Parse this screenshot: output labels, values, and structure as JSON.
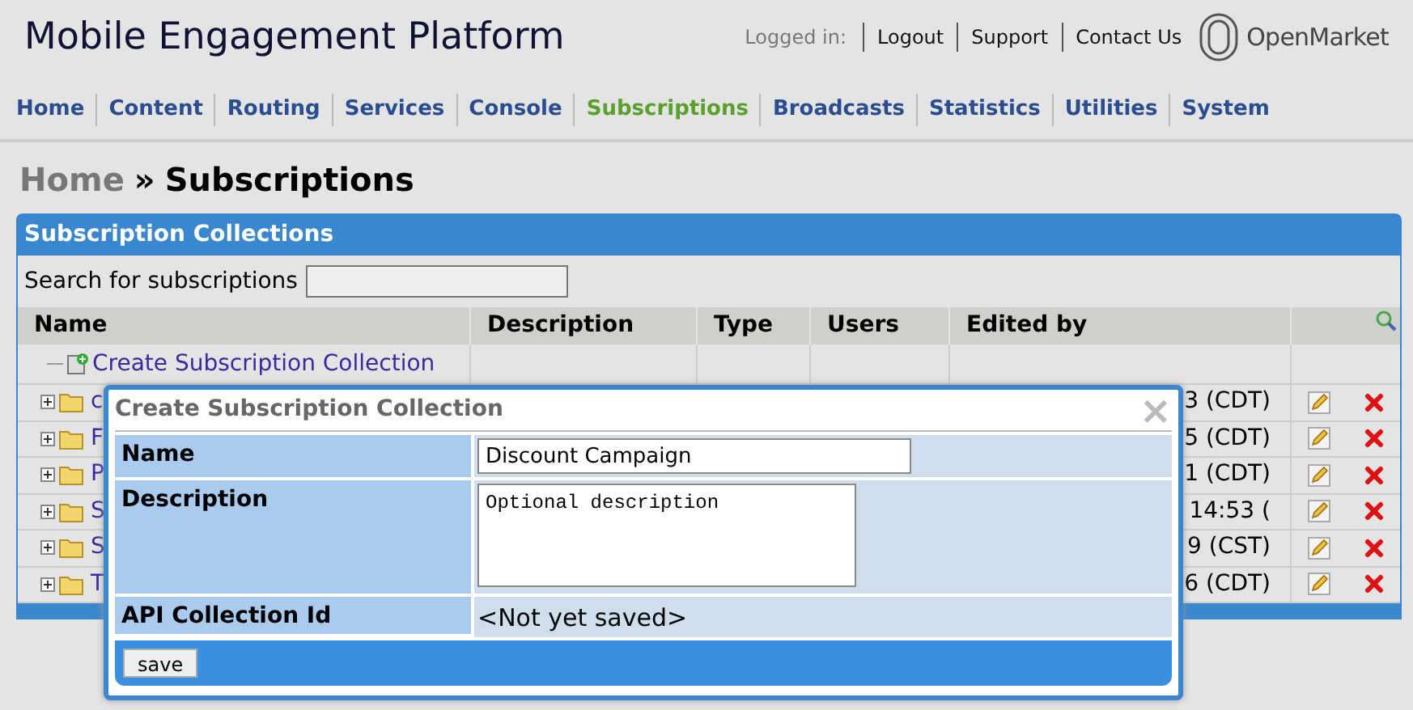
{
  "header": {
    "title": "Mobile Engagement Platform",
    "logged_in_label": "Logged in:",
    "links": [
      "Logout",
      "Support",
      "Contact Us"
    ],
    "logo_text": "OpenMarket"
  },
  "nav": [
    {
      "label": "Home",
      "selected": false
    },
    {
      "label": "Content",
      "selected": false
    },
    {
      "label": "Routing",
      "selected": false
    },
    {
      "label": "Services",
      "selected": false
    },
    {
      "label": "Console",
      "selected": false
    },
    {
      "label": "Subscriptions",
      "selected": true
    },
    {
      "label": "Broadcasts",
      "selected": false
    },
    {
      "label": "Statistics",
      "selected": false
    },
    {
      "label": "Utilities",
      "selected": false
    },
    {
      "label": "System",
      "selected": false
    }
  ],
  "breadcrumb": {
    "parent": "Home",
    "separator": "»",
    "current": "Subscriptions"
  },
  "panel": {
    "title": "Subscription Collections",
    "search_label": "Search for subscriptions",
    "columns": [
      "Name",
      "Description",
      "Type",
      "Users",
      "Edited by"
    ],
    "create_link": "Create Subscription Collection",
    "rows": [
      {
        "name": "c",
        "edited_by": "3 (CDT)"
      },
      {
        "name": "F",
        "edited_by": "5 (CDT)"
      },
      {
        "name": "P",
        "edited_by": "1 (CDT)"
      },
      {
        "name": "S",
        "edited_by": "14:53 ("
      },
      {
        "name": "S",
        "edited_by": "9 (CST)"
      },
      {
        "name": "T",
        "edited_by": "6 (CDT)"
      }
    ]
  },
  "dialog": {
    "title": "Create Subscription Collection",
    "close": "×",
    "fields": [
      {
        "kind": "input",
        "label": "Name",
        "value": "Discount Campaign"
      },
      {
        "kind": "textarea",
        "label": "Description",
        "value": "Optional description"
      },
      {
        "kind": "text",
        "label": "API Collection Id",
        "value": "<Not yet saved>"
      }
    ],
    "button": "save"
  }
}
